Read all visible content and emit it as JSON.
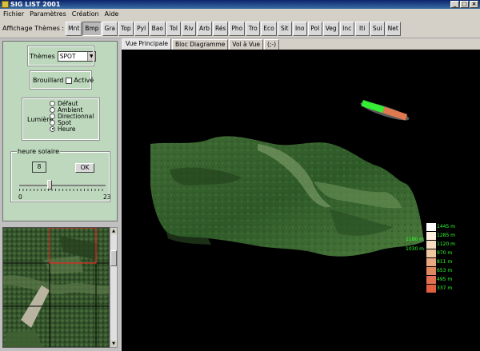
{
  "window": {
    "title": "SIG LIST 2001"
  },
  "menu": [
    "Fichier",
    "Paramètres",
    "Création",
    "Aide"
  ],
  "toolbar": {
    "label": "Affichage Thèmes :",
    "buttons": [
      "Mnt",
      "Bmp",
      "Gra",
      "Top",
      "Pyl",
      "Bao",
      "Tol",
      "Riv",
      "Arb",
      "Rés",
      "Pho",
      "Tro",
      "Eco",
      "Sit",
      "Ino",
      "Pol",
      "Veg",
      "Inc",
      "Iti",
      "Sui",
      "Net"
    ],
    "active_button": "Bmp"
  },
  "panel": {
    "themes_label": "Thèmes",
    "themes_value": "SPOT",
    "fog_label": "Brouillard",
    "fog_checkbox_label": "Activé",
    "light_label": "Lumière",
    "light_options": [
      "Défaut",
      "Ambient",
      "Directionnal",
      "Spot",
      "Heure"
    ],
    "light_selected": "Heure",
    "solar_group_label": "heure solaire",
    "solar_value": "8",
    "ok_label": "OK",
    "slider_min": "0",
    "slider_max": "23",
    "slider_value": 8
  },
  "tabs": [
    "Vue Principale",
    "Bloc Diagramme",
    "Vol à Vue",
    "(;-)"
  ],
  "active_tab": "Vue Principale",
  "colorbar": {
    "labels": [
      "1445 m",
      "1285 m",
      "1120 m",
      "970 m",
      "811 m",
      "653 m",
      "495 m",
      "337 m"
    ],
    "colors": [
      "#ffffff",
      "#fff0e0",
      "#f8dcc0",
      "#f0c8a0",
      "#e8a880",
      "#e08860",
      "#e07050",
      "#e06040"
    ]
  },
  "altitude_markers": [
    "1180 m",
    "1030 m"
  ]
}
